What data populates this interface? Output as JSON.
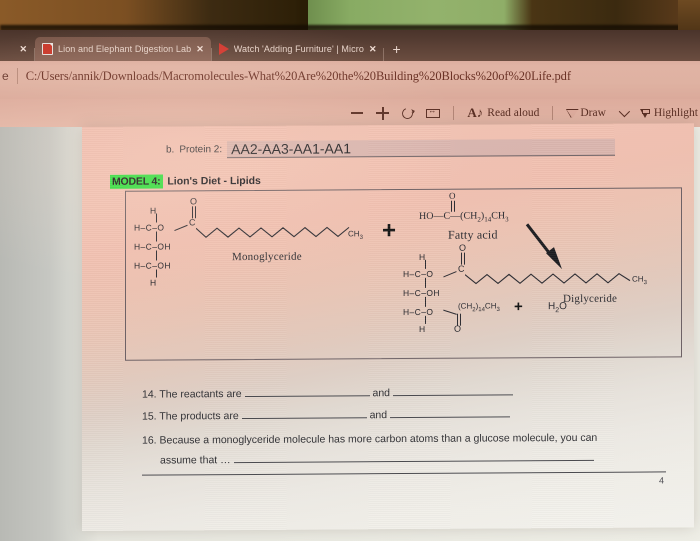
{
  "browser": {
    "tabs": [
      {
        "label": "",
        "favicon": "none",
        "partial": true,
        "active": false
      },
      {
        "label": "Lion and Elephant Digestion Lab",
        "favicon": "pdf-icon",
        "partial": false,
        "active": true
      },
      {
        "label": "Watch 'Adding Furniture' | Micro",
        "favicon": "play-icon",
        "partial": false,
        "active": false
      }
    ],
    "new_tab_glyph": "+",
    "close_glyph": "✕",
    "address_partial": "e",
    "url": "C:/Users/annik/Downloads/Macromolecules-What%20Are%20the%20Building%20Blocks%20of%20Life.pdf"
  },
  "toolbar": {
    "zoom_out": "zoom-out",
    "zoom_in": "zoom-in",
    "rotate": "rotate",
    "fit_page": "fit-to-width",
    "read_aloud_label": "Read aloud",
    "draw_label": "Draw",
    "draw_chevron": "⌄",
    "highlight_label": "Highlight"
  },
  "document": {
    "protein2": {
      "letter": "b.",
      "label": "Protein 2:",
      "answer": "AA2-AA3-AA1-AA1"
    },
    "model": {
      "tag": "MODEL 4:",
      "title": "Lion's Diet - Lipids"
    },
    "diagram": {
      "monoglyceride": {
        "name": "Monoglyceride",
        "backbone": [
          {
            "text": "H",
            "kind": "top-h"
          },
          {
            "text": "H–C–O",
            "kind": "c1"
          },
          {
            "text": "H–C–OH",
            "kind": "c2"
          },
          {
            "text": "H–C–OH",
            "kind": "c3"
          },
          {
            "text": "H",
            "kind": "bottom-h"
          }
        ],
        "carbonyl_o": "O",
        "carbonyl_c": "C",
        "chain_end": "CH3"
      },
      "plus_sign": "+",
      "fatty_acid": {
        "name": "Fatty acid",
        "formula_prefix": "HO—C—(CH",
        "formula_full": "HO—C—(CH2)14CH3",
        "carbonyl_o": "O"
      },
      "arrow": "down-right-arrow",
      "diglyceride": {
        "name": "Diglyceride",
        "backbone": [
          {
            "text": "H",
            "kind": "top-h"
          },
          {
            "text": "H–C–O",
            "kind": "c1"
          },
          {
            "text": "H–C–OH",
            "kind": "c2"
          },
          {
            "text": "H–C–O",
            "kind": "c3"
          },
          {
            "text": "H",
            "kind": "bottom-h"
          }
        ],
        "carbonyl_o": "O",
        "carbonyl_c": "C",
        "chain_end": "CH3",
        "lower_chain": "(CH2)14CH3",
        "lower_carbonyl_o": "O"
      },
      "plus_sign_2": "+",
      "water": "H2O"
    },
    "questions": [
      {
        "number": "14.",
        "text_before": "The reactants are",
        "conjunction": "and",
        "text_after": ""
      },
      {
        "number": "15.",
        "text_before": "The products are",
        "conjunction": "and",
        "text_after": ""
      },
      {
        "number": "16.",
        "text_line1": "Because a monoglyceride molecule has more carbon atoms than a glucose molecule, you can",
        "text_line2": "assume that …"
      }
    ],
    "page_number": "4"
  }
}
